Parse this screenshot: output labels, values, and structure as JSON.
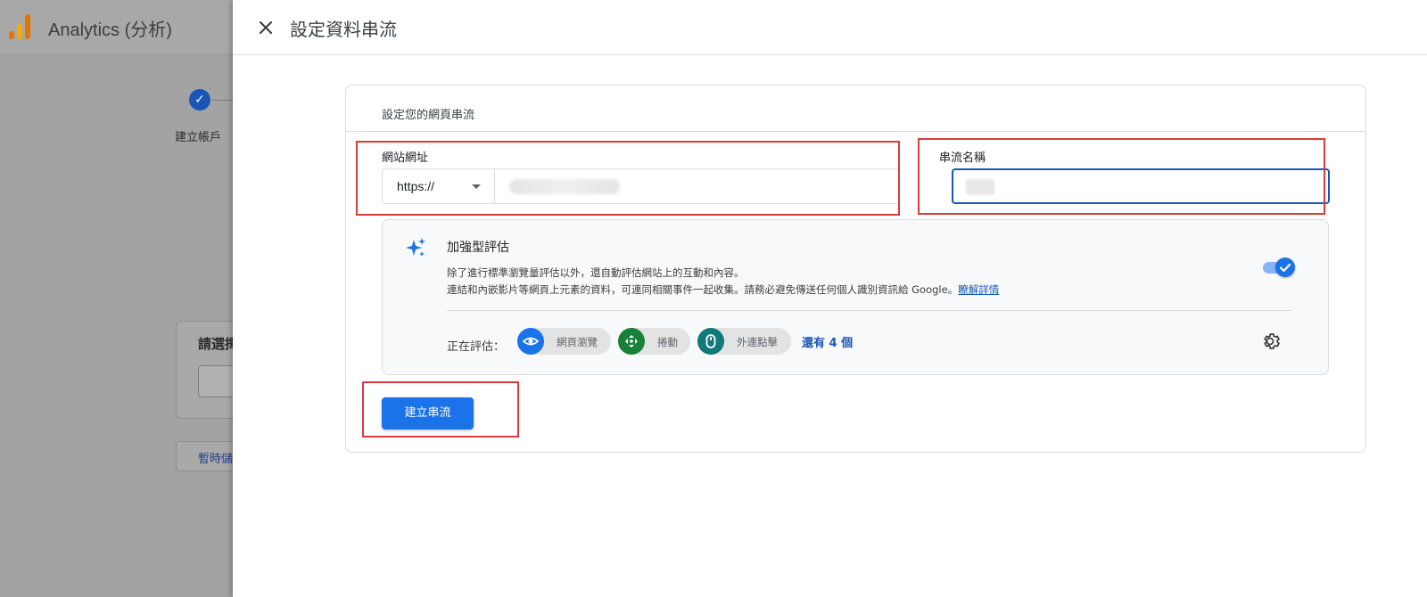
{
  "background": {
    "app_title": "Analytics (分析)",
    "step_label": "建立帳戶",
    "step_check": "✓",
    "card_title": "請選擇",
    "save_label": "暫時儲"
  },
  "panel": {
    "title": "設定資料串流",
    "card_heading": "設定您的網頁串流",
    "website_url_label": "網站網址",
    "protocol_value": "https://",
    "stream_name_label": "串流名稱",
    "enhanced": {
      "title": "加強型評估",
      "description_line1": "除了進行標準瀏覽量評估以外，還自動評估網站上的互動和內容。",
      "description_line2": "連結和內嵌影片等網頁上元素的資料，可連同相關事件一起收集。請務必避免傳送任何個人識別資訊給 Google。",
      "learn_more": "瞭解詳情",
      "toggle_on": true,
      "measuring_label": "正在評估：",
      "chips": [
        {
          "label": "網頁瀏覽",
          "icon": "eye-icon",
          "color": "#1a73e8"
        },
        {
          "label": "捲動",
          "icon": "scroll-arrows-icon",
          "color": "#188038"
        },
        {
          "label": "外連點擊",
          "icon": "mouse-icon",
          "color": "#12797a"
        }
      ],
      "more": "還有 4 個"
    },
    "create_button": "建立串流"
  },
  "colors": {
    "primary": "#1a73e8",
    "highlight_border": "#d93b3b"
  }
}
